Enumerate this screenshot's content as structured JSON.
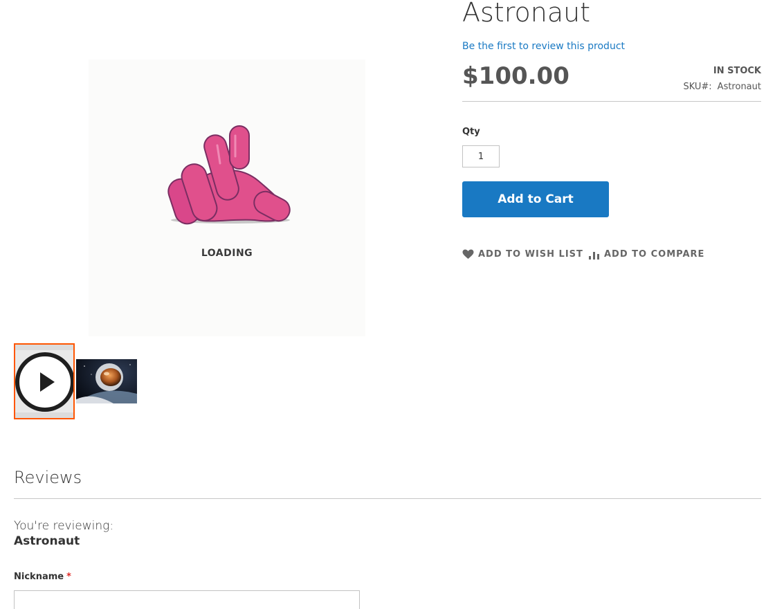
{
  "product": {
    "title": "Astronaut",
    "review_link": "Be the first to review this product",
    "price": "$100.00",
    "stock_status": "IN STOCK",
    "sku_label": "SKU#:",
    "sku_value": "Astronaut"
  },
  "gallery": {
    "loading_text": "LOADING",
    "thumbnails": [
      {
        "kind": "video",
        "icon": "play-icon",
        "active": true
      },
      {
        "kind": "image",
        "subject": "astronaut photo",
        "active": false
      }
    ],
    "accent_color": "#ff5501"
  },
  "purchase": {
    "qty_label": "Qty",
    "qty_value": "1",
    "add_to_cart": "Add to Cart",
    "button_color": "#1979c3"
  },
  "actions": {
    "wishlist": "ADD TO WISH LIST",
    "wishlist_icon": "heart-icon",
    "compare": "ADD TO COMPARE",
    "compare_icon": "bar-chart-icon"
  },
  "reviews": {
    "title": "Reviews",
    "reviewing_legend": "You're reviewing:",
    "reviewing_product": "Astronaut",
    "nickname_label": "Nickname",
    "required_mark": "*",
    "nickname_value": ""
  }
}
